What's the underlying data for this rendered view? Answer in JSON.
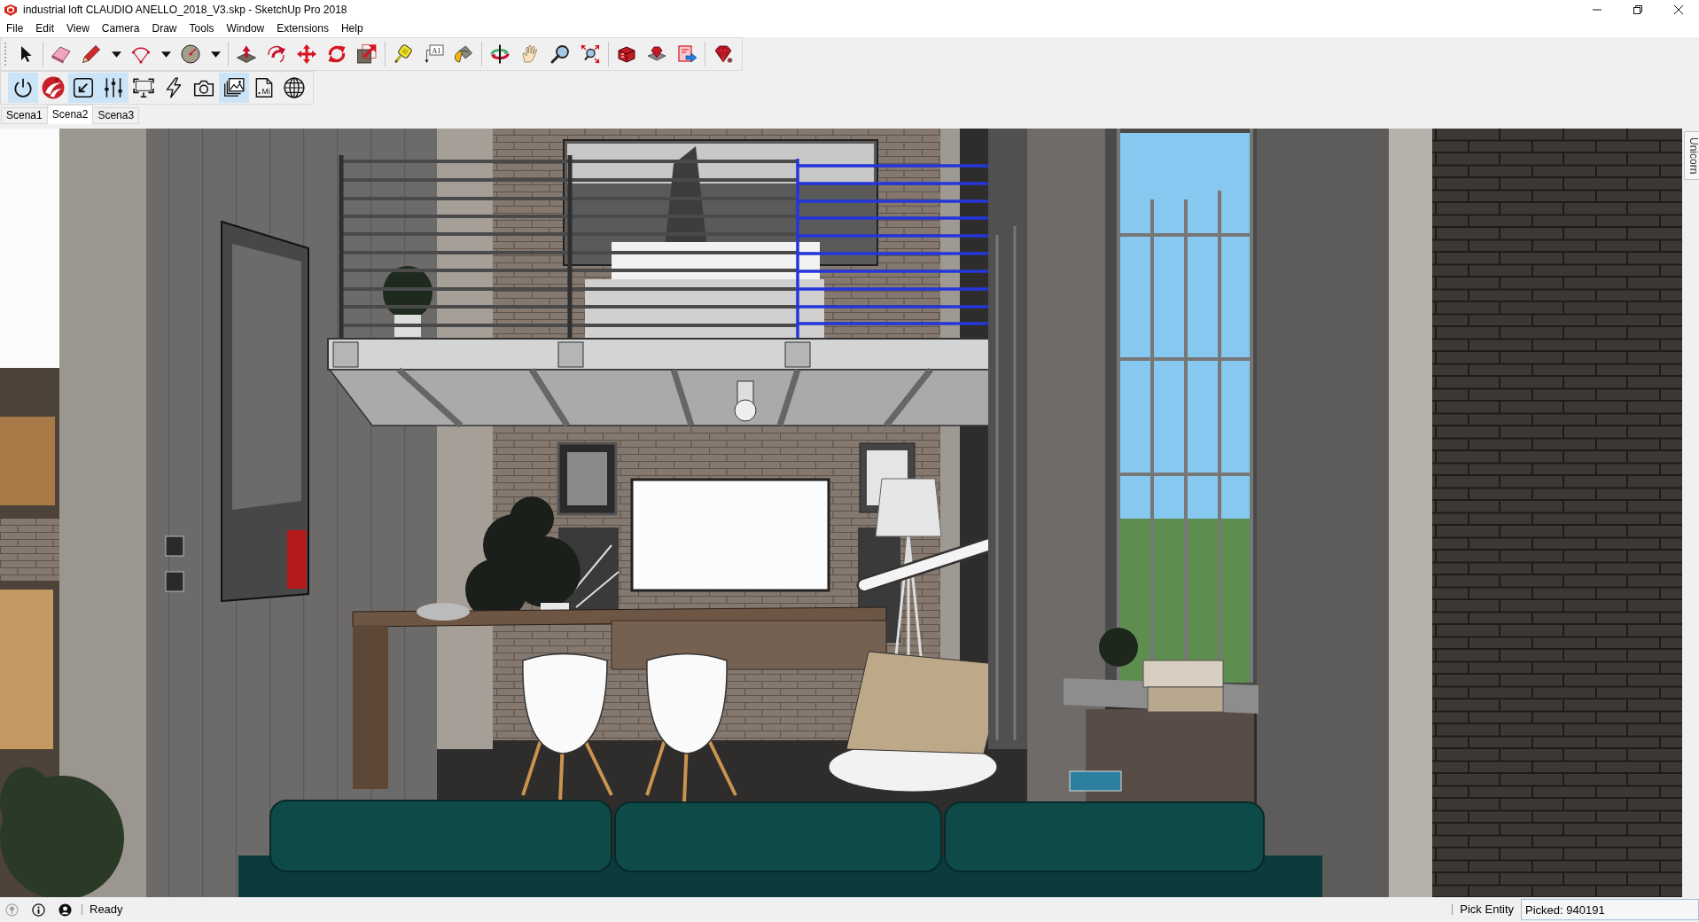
{
  "window": {
    "title": "industrial loft CLAUDIO ANELLO_2018_V3.skp - SketchUp Pro 2018"
  },
  "menu": [
    "File",
    "Edit",
    "View",
    "Camera",
    "Draw",
    "Tools",
    "Window",
    "Extensions",
    "Help"
  ],
  "main_toolbar": {
    "text_tool_icon_text": "A1"
  },
  "unicorn_toolbar": [
    {
      "selected": true
    },
    {
      "selected": false
    },
    {
      "selected": true
    },
    {
      "selected": true
    },
    {
      "selected": false
    },
    {
      "selected": false
    },
    {
      "selected": false
    },
    {
      "selected": true
    },
    {
      "selected": false,
      "icon_text": "Mi"
    },
    {
      "selected": false
    }
  ],
  "scene_tabs": [
    {
      "label": "Scena1",
      "selected": false
    },
    {
      "label": "Scena2",
      "selected": true
    },
    {
      "label": "Scena3",
      "selected": false
    }
  ],
  "side_panel": {
    "tab_label": "Unicorn"
  },
  "status_bar": {
    "icons": [
      {
        "dimmed": true
      },
      {
        "dimmed": false
      },
      {
        "dimmed": false
      }
    ],
    "status_text": "Ready",
    "tool_hint": "Pick Entity",
    "measurements": {
      "value": "Picked: 940191"
    }
  }
}
